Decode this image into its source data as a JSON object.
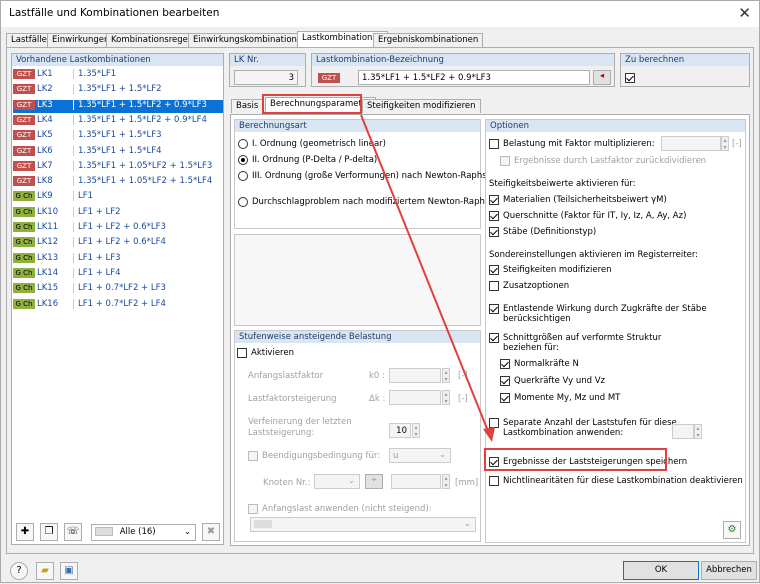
{
  "window": {
    "title": "Lastfälle und Kombinationen bearbeiten",
    "close": "✕"
  },
  "tabs": [
    "Lastfälle",
    "Einwirkungen",
    "Kombinationsregeln",
    "Einwirkungskombinationen",
    "Lastkombinationen",
    "Ergebniskombinationen"
  ],
  "left": {
    "header": "Vorhandene Lastkombinationen",
    "items": [
      {
        "badge": "GZT",
        "id": "LK1",
        "formula": "1.35*LF1"
      },
      {
        "badge": "GZT",
        "id": "LK2",
        "formula": "1.35*LF1 + 1.5*LF2"
      },
      {
        "badge": "GZT",
        "id": "LK3",
        "formula": "1.35*LF1 + 1.5*LF2 + 0.9*LF3"
      },
      {
        "badge": "GZT",
        "id": "LK4",
        "formula": "1.35*LF1 + 1.5*LF2 + 0.9*LF4"
      },
      {
        "badge": "GZT",
        "id": "LK5",
        "formula": "1.35*LF1 + 1.5*LF3"
      },
      {
        "badge": "GZT",
        "id": "LK6",
        "formula": "1.35*LF1 + 1.5*LF4"
      },
      {
        "badge": "GZT",
        "id": "LK7",
        "formula": "1.35*LF1 + 1.05*LF2 + 1.5*LF3"
      },
      {
        "badge": "GZT",
        "id": "LK8",
        "formula": "1.35*LF1 + 1.05*LF2 + 1.5*LF4"
      },
      {
        "badge": "G Ch",
        "id": "LK9",
        "formula": "LF1"
      },
      {
        "badge": "G Ch",
        "id": "LK10",
        "formula": "LF1 + LF2"
      },
      {
        "badge": "G Ch",
        "id": "LK11",
        "formula": "LF1 + LF2 + 0.6*LF3"
      },
      {
        "badge": "G Ch",
        "id": "LK12",
        "formula": "LF1 + LF2 + 0.6*LF4"
      },
      {
        "badge": "G Ch",
        "id": "LK13",
        "formula": "LF1 + LF3"
      },
      {
        "badge": "G Ch",
        "id": "LK14",
        "formula": "LF1 + LF4"
      },
      {
        "badge": "G Ch",
        "id": "LK15",
        "formula": "LF1 + 0.7*LF2 + LF3"
      },
      {
        "badge": "G Ch",
        "id": "LK16",
        "formula": "LF1 + 0.7*LF2 + LF4"
      }
    ],
    "filter": "Alle (16)"
  },
  "lk": {
    "label": "LK Nr.",
    "value": "3",
    "bez_label": "Lastkombination-Bezeichnung",
    "badge": "GZT",
    "bez_value": "1.35*LF1 + 1.5*LF2 + 0.9*LF3",
    "zu_label": "Zu berechnen"
  },
  "subtabs": [
    "Basis",
    "Berechnungsparameter",
    "Steifigkeiten modifizieren"
  ],
  "art": {
    "header": "Berechnungsart",
    "opt1": "I. Ordnung (geometrisch linear)",
    "opt2": "II. Ordnung (P-Delta / P-delta)",
    "opt3": "III. Ordnung (große Verformungen) nach Newton-Raphson",
    "opt4": "Durchschlagproblem nach modifiziertem Newton-Raphson"
  },
  "stufen": {
    "header": "Stufenweise ansteigende Belastung",
    "aktivieren": "Aktivieren",
    "anfang": "Anfangslastfaktor",
    "anfang_sym": "k0 :",
    "steig": "Lastfaktorsteigerung",
    "steig_sym": "Δk :",
    "verf": "Verfeinerung der letzten",
    "verf2": "Laststeigerung:",
    "verf_val": "10",
    "beend": "Beendigungsbedingung für:",
    "beend_val": "u",
    "knoten": "Knoten Nr.:",
    "unit_mm": "[mm]",
    "unit_dash": "[-]",
    "anfangslast": "Anfangslast anwenden (nicht steigend):"
  },
  "opt": {
    "header": "Optionen",
    "mult": "Belastung mit Faktor multiplizieren:",
    "mult_unit": "[-]",
    "divid": "Ergebnisse durch Lastfaktor zurückdividieren",
    "steif_h": "Steifigkeitsbeiwerte aktivieren für:",
    "mat": "Materialien (Teilsicherheitsbeiwert γM)",
    "quer": "Querschnitte (Faktor für IT, Iy, Iz, A, Ay, Az)",
    "staebe": "Stäbe (Definitionstyp)",
    "sonder": "Sondereinstellungen aktivieren im Registerreiter:",
    "steifmod": "Steifigkeiten modifizieren",
    "zusatz": "Zusatzoptionen",
    "entl": "Entlastende Wirkung durch Zugkräfte der Stäbe",
    "entl2": "berücksichtigen",
    "schnitt": "Schnittgrößen auf verformte Struktur",
    "schnitt2": "beziehen für:",
    "normal": "Normalkräfte N",
    "querk": "Querkräfte Vy und Vz",
    "momente": "Momente My, Mz und MT",
    "separat": "Separate Anzahl der Laststufen für diese",
    "separat2": "Lastkombination anwenden:",
    "ergeb": "Ergebnisse der Laststeigerungen speichern",
    "nicht": "Nichtlinearitäten für diese Lastkombination deaktivieren"
  },
  "bottom": {
    "ok": "OK",
    "cancel": "Abbrechen"
  },
  "colors": {
    "accent": "#0a72d6",
    "gzt": "#c0504d",
    "gch": "#8db03f",
    "highlight": "#e04040"
  }
}
